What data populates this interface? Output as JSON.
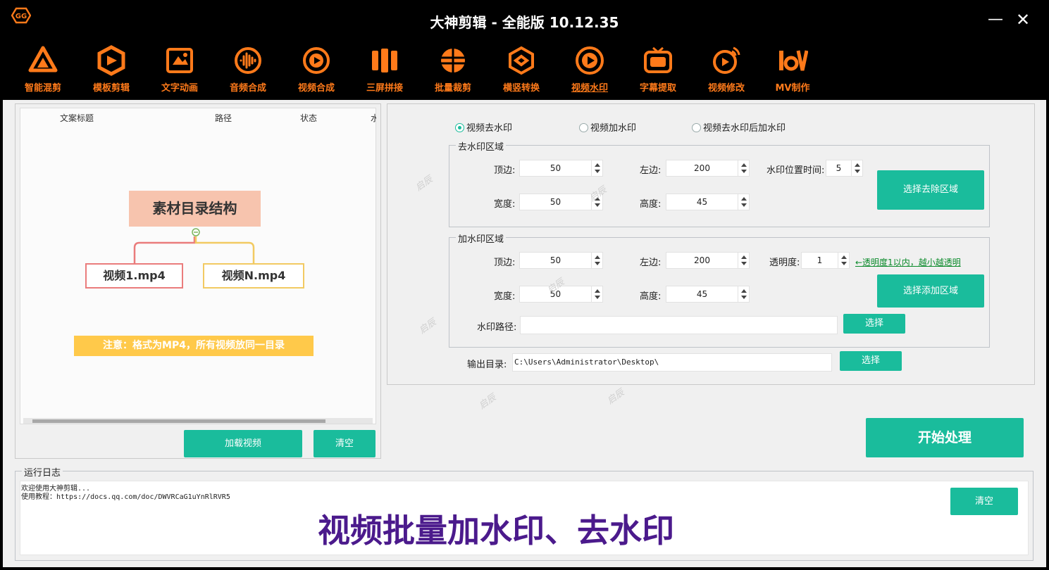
{
  "window": {
    "title": "大神剪辑 - 全能版 10.12.35",
    "minimize": "—",
    "close": "✕"
  },
  "toolbar": {
    "items": [
      {
        "label": "智能混剪",
        "icon": "triangle-logo-icon"
      },
      {
        "label": "模板剪辑",
        "icon": "hexagon-template-icon"
      },
      {
        "label": "文字动画",
        "icon": "text-frame-icon"
      },
      {
        "label": "音频合成",
        "icon": "audio-wave-icon"
      },
      {
        "label": "视频合成",
        "icon": "play-circle-icon"
      },
      {
        "label": "三屏拼接",
        "icon": "triple-screen-icon"
      },
      {
        "label": "批量裁剪",
        "icon": "crop-ball-icon"
      },
      {
        "label": "横竖转换",
        "icon": "rotate-cube-icon"
      },
      {
        "label": "视频水印",
        "icon": "watermark-play-icon"
      },
      {
        "label": "字幕提取",
        "icon": "subtitle-tv-icon"
      },
      {
        "label": "视频修改",
        "icon": "edit-play-icon"
      },
      {
        "label": "MV制作",
        "icon": "mv-logo-icon"
      }
    ],
    "active_index": 8,
    "accent_color": "#ff7a1a"
  },
  "list": {
    "columns": [
      "文案标题",
      "路径",
      "状态",
      "水"
    ]
  },
  "diagram": {
    "title": "素材目录结构",
    "node1": "视频1.mp4",
    "node2": "视频N.mp4",
    "note": "注意：格式为MP4，所有视频放同一目录"
  },
  "left_buttons": {
    "load": "加载视频",
    "clear": "清空"
  },
  "modes": {
    "options": [
      "视频去水印",
      "视频加水印",
      "视频去水印后加水印"
    ],
    "selected_index": 0
  },
  "remove_group": {
    "label": "去水印区域",
    "top_label": "顶边:",
    "top_value": "50",
    "left_label": "左边:",
    "left_value": "200",
    "time_label": "水印位置时间:",
    "time_value": "5",
    "width_label": "宽度:",
    "width_value": "50",
    "height_label": "高度:",
    "height_value": "45",
    "select_btn": "选择去除区域"
  },
  "add_group": {
    "label": "加水印区域",
    "top_label": "顶边:",
    "top_value": "50",
    "left_label": "左边:",
    "left_value": "200",
    "opacity_label": "透明度:",
    "opacity_value": "1",
    "opacity_hint": "←透明度1以内，越小越透明",
    "width_label": "宽度:",
    "width_value": "50",
    "height_label": "高度:",
    "height_value": "45",
    "select_btn": "选择添加区域",
    "path_label": "水印路径:",
    "path_value": "",
    "choose_btn": "选择"
  },
  "output": {
    "label": "输出目录:",
    "value": "C:\\Users\\Administrator\\Desktop\\",
    "choose_btn": "选择"
  },
  "start_btn": "开始处理",
  "watermark_text": "启辰",
  "log": {
    "label": "运行日志",
    "lines": [
      "欢迎使用大神剪辑...",
      "使用教程：https://docs.qq.com/doc/DWVRCaG1uYnRlRVR5"
    ],
    "clear_btn": "清空"
  },
  "caption": "视频批量加水印、去水印",
  "colors": {
    "primary_green": "#1abc9c",
    "caption_purple": "#4b1a8c",
    "title_bar": "#000000"
  }
}
